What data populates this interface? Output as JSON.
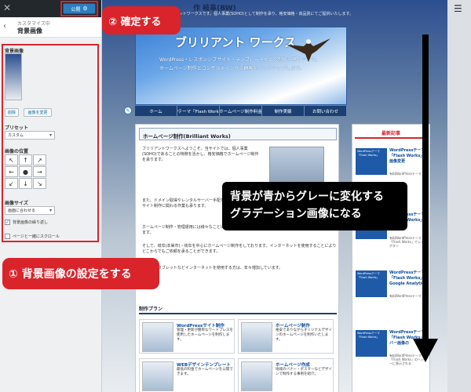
{
  "customizer": {
    "publish_label": "公開",
    "breadcrumb": "カスタマイズ中",
    "section_title": "背景画像",
    "bg_image_label": "背景画像",
    "remove_label": "削除",
    "change_label": "画像を変更",
    "preset_label": "プリセット",
    "preset_value": "カスタム",
    "position_label": "画像の位置",
    "position_arrows": [
      "↖",
      "↑",
      "↗",
      "←",
      "●",
      "→",
      "↙",
      "↓",
      "↘"
    ],
    "size_label": "画像サイズ",
    "size_value": "画面に合わせる",
    "repeat_label": "背景画像の繰り返し",
    "scroll_label": "ページと一緒にスクロール"
  },
  "callouts": {
    "publish": "② 確定する",
    "settings": "① 背景画像の設定をする",
    "change_line1": "背景が青からグレーに変化する",
    "change_line2": "グラデーション画像になる"
  },
  "site": {
    "name": "作 岐阜(BW)",
    "description": "リアントワークスです。個人事業(SOHO)として制作を承り、格安価格・高品質にてご提供いたします。",
    "banner_title": "ブリリアント ワークス",
    "banner_line1": "WordPress・レスポンシブサイト・テンプレートなどの制作を承り中です。",
    "banner_line2": "ホームページ制作とコンサルティングで顧客をバックアップします。",
    "nav": [
      "ホーム",
      "WPテーマ「Flash Works」",
      "ホームページ制作料金",
      "制作実績",
      "お問い合わせ"
    ],
    "content_heading": "ホームページ制作(Brilliant Works)",
    "para1": "ブリリアントワークスへようこそ。当サイトでは、個人事業(SOHO)であることの特徴を活かし、格安価格でホームページ制作を承ります。",
    "para2": "また、ドメイン取得やレンタルサーバー手配など、WEBサイト制作に関わる作業も承ります。",
    "para3": "ホームページ制作・管理運用には様々なことに対応いたします。",
    "para4": "そして、岐阜(本巣市)・岐阜を中心にホームページ制作をしております。インターネットを使用することによりどこからでもご依頼を承ることができます。",
    "para5": "スマホ・タブレットなどインターネットを使用する方は、年々増加しています。",
    "production_heading": "制作プラン",
    "cards": [
      {
        "title": "WordPressサイト制作",
        "text": "管理・更新が簡単なワードプレスを使用したホームページを制作します。"
      },
      {
        "title": "ホームページ制作",
        "text": "格安でありながらオリジナルデザインのホームページを制作いたします。"
      },
      {
        "title": "WEBデザインテンプレート",
        "text": "最低の料金でホームページを公開できます。"
      },
      {
        "title": "ホームページ作成",
        "text": "地域のバナー・ポスターなどデザインで制作する事例を紹介。"
      }
    ],
    "side_heading": "最新記事",
    "side_items": [
      {
        "img": "WordPressテーマ「Flash Works」",
        "title": "WordPressテーマ「Flash Works」の画像変更",
        "sub": "有料WordPressテーマ"
      },
      {
        "img": "WordPressテーマ「Flash Works」",
        "title": "WordPressテーマ「Flash Works」のシェア",
        "sub": "有料WordPressテーマ「Flash Works」でシャルボタン"
      },
      {
        "img": "WordPressテーマ「Flash Works」",
        "title": "WordPressテーマ「Flash Works」Google Analytics",
        "sub": "有料WordPressテーマ"
      },
      {
        "img": "WordPressテーマ「Flash Works」",
        "title": "WordPressテーマ「Flash Works」でバー画像の",
        "sub": "有料WordPressテーマ「Flash Works」のヘッダーに表示される"
      }
    ]
  }
}
